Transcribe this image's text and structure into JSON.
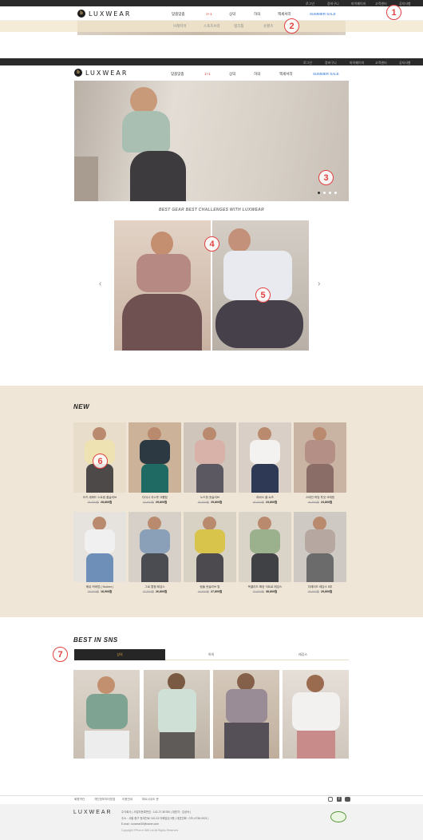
{
  "colors": {
    "accent_red": "#e04040",
    "brand_dark": "#2a2a2a",
    "sale_blue": "#2a72d6",
    "new_bg": "#efe6d7"
  },
  "logo": {
    "mark": "b",
    "text": "LUXWEAR"
  },
  "util_links": [
    "로그인",
    "장바구니",
    "마이페이지",
    "고객센터",
    "공지사항"
  ],
  "gnb": [
    "맞춤맞춤",
    "1+1",
    "상의",
    "하의",
    "액세서리",
    "SUMMER SALE"
  ],
  "submenu": [
    "브래지어",
    "스포츠브라",
    "탱크톱",
    "숏팬츠"
  ],
  "callouts": [
    "1",
    "2",
    "3",
    "4",
    "5",
    "6",
    "7"
  ],
  "hero": {
    "slide_dots": 4
  },
  "best_gear": {
    "title": "BEST GEAR BEST CHALLENGES WITH LUXWEAR",
    "prev_icon": "chevron-left",
    "next_icon": "chevron-right"
  },
  "new_section": {
    "title": "NEW",
    "products": [
      {
        "name": "오키 세퍼드 스트링 롱슬리브",
        "orig": "36,800원",
        "price": "28,800원"
      },
      {
        "name": "다이나 석스루 크롭탑",
        "orig": "32,800원",
        "price": "29,800원"
      },
      {
        "name": "노드힛 숏슬리브",
        "orig": "39,800원",
        "price": "25,800원"
      },
      {
        "name": "리버스 쿨 쇼츠",
        "orig": "46,800원",
        "price": "23,800원"
      },
      {
        "name": "스테인 허밍 투것 크레빙",
        "orig": "46,800원",
        "price": "23,800원"
      },
      {
        "name": "에쉬 커버업 ( 9colors )",
        "orig": "28,800원",
        "price": "18,900원"
      },
      {
        "name": "그로 랩핑 레깅스",
        "orig": "32,800원",
        "price": "26,800원"
      },
      {
        "name": "림들 숏슬리브 탑",
        "orig": "34,800원",
        "price": "27,800원"
      },
      {
        "name": "옥클리드 확장 석트로 레깅스",
        "orig": "70,800원",
        "price": "38,800원"
      },
      {
        "name": "더레이드 레깅스 5부",
        "orig": "46,800원",
        "price": "25,800원"
      }
    ]
  },
  "sns": {
    "title": "BEST IN SNS",
    "tabs": [
      "상의",
      "하의",
      "레깅스"
    ],
    "active_tab": 0
  },
  "footer": {
    "links": [
      "회원약관",
      "개인정보처리방침",
      "이용안내",
      "파트너쉬도 문"
    ],
    "info_lines": [
      "주식회사  |  사업자등록번호 : 142-27-80780  |  대표자 : 김상숙  |",
      "주소 : 서울 중구 청계천로 110-23 더베일딩 3층  |  대표전화 : 070-4738-0021  |",
      "E-mail : luxwear30@naver.com",
      "Copyright ©Plus In 886 Ltd All Rights Reserved"
    ],
    "social_icons": [
      "instagram-icon",
      "facebook-icon",
      "youtube-icon"
    ]
  }
}
